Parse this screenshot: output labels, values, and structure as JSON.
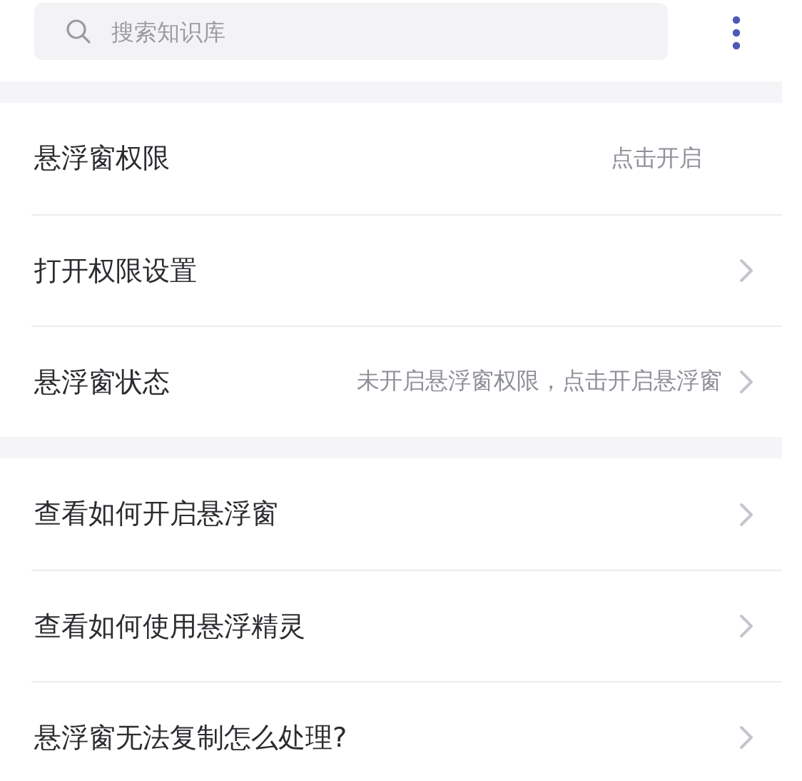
{
  "search": {
    "placeholder": "搜索知识库"
  },
  "sections": [
    {
      "items": [
        {
          "label": "悬浮窗权限",
          "value": "点击开启",
          "arrow": false
        },
        {
          "label": "打开权限设置",
          "arrow": true
        },
        {
          "label": "悬浮窗状态",
          "value": "未开启悬浮窗权限，点击开启悬浮窗",
          "arrow": true
        }
      ]
    },
    {
      "items": [
        {
          "label": "查看如何开启悬浮窗",
          "arrow": true
        },
        {
          "label": "查看如何使用悬浮精灵",
          "arrow": true
        },
        {
          "label": "悬浮窗无法复制怎么处理?",
          "arrow": true
        }
      ]
    }
  ]
}
